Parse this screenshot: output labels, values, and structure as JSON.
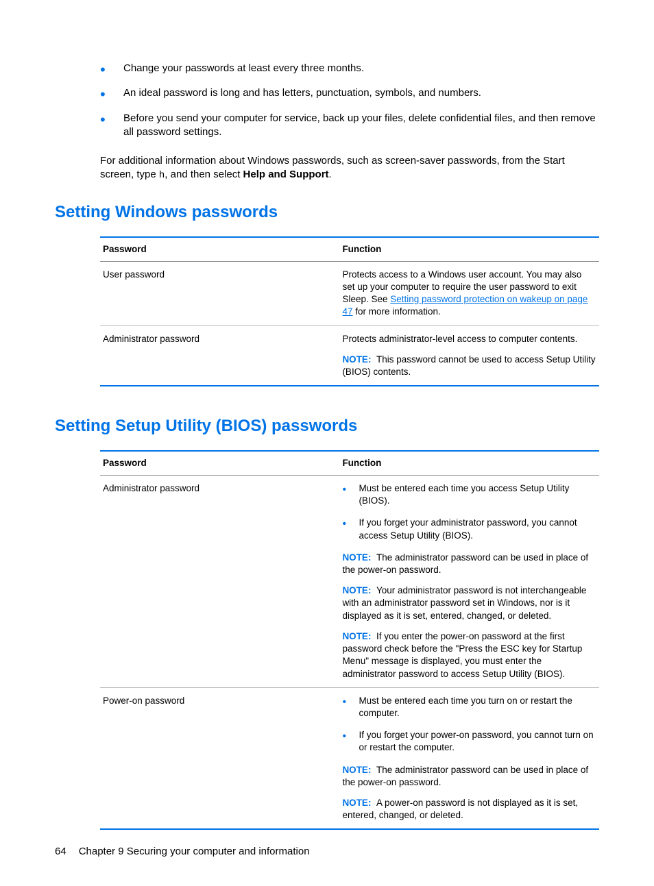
{
  "tips": [
    "Change your passwords at least every three months.",
    "An ideal password is long and has letters, punctuation, symbols, and numbers.",
    "Before you send your computer for service, back up your files, delete confidential files, and then remove all password settings."
  ],
  "additional_info": {
    "pre": "For additional information about Windows passwords, such as screen-saver passwords, from the Start screen, type ",
    "code": "h",
    "mid": ", and then select ",
    "bold": "Help and Support",
    "post": "."
  },
  "sections": {
    "windows": {
      "heading": "Setting Windows passwords",
      "headers": {
        "password": "Password",
        "function": "Function"
      },
      "rows": {
        "user": {
          "name": "User password",
          "desc_pre": "Protects access to a Windows user account. You may also set up your computer to require the user password to exit Sleep. See ",
          "link": "Setting password protection on wakeup on page 47",
          "desc_post": " for more information."
        },
        "admin": {
          "name": "Administrator password",
          "desc": "Protects administrator-level access to computer contents.",
          "note_label": "NOTE:",
          "note": "This password cannot be used to access Setup Utility (BIOS) contents."
        }
      }
    },
    "bios": {
      "heading": "Setting Setup Utility (BIOS) passwords",
      "headers": {
        "password": "Password",
        "function": "Function"
      },
      "rows": {
        "admin": {
          "name": "Administrator password",
          "bullets": [
            "Must be entered each time you access Setup Utility (BIOS).",
            "If you forget your administrator password, you cannot access Setup Utility (BIOS)."
          ],
          "notes": [
            {
              "label": "NOTE:",
              "text": "The administrator password can be used in place of the power-on password."
            },
            {
              "label": "NOTE:",
              "text": "Your administrator password is not interchangeable with an administrator password set in Windows, nor is it displayed as it is set, entered, changed, or deleted."
            },
            {
              "label": "NOTE:",
              "text": "If you enter the power-on password at the first password check before the \"Press the ESC key for Startup Menu\" message is displayed, you must enter the administrator password to access Setup Utility (BIOS)."
            }
          ]
        },
        "poweron": {
          "name": "Power-on password",
          "bullets": [
            "Must be entered each time you turn on or restart the computer.",
            "If you forget your power-on password, you cannot turn on or restart the computer."
          ],
          "notes": [
            {
              "label": "NOTE:",
              "text": "The administrator password can be used in place of the power-on password."
            },
            {
              "label": "NOTE:",
              "text": "A power-on password is not displayed as it is set, entered, changed, or deleted."
            }
          ]
        }
      }
    }
  },
  "footer": {
    "page": "64",
    "chapter": "Chapter 9   Securing your computer and information"
  }
}
